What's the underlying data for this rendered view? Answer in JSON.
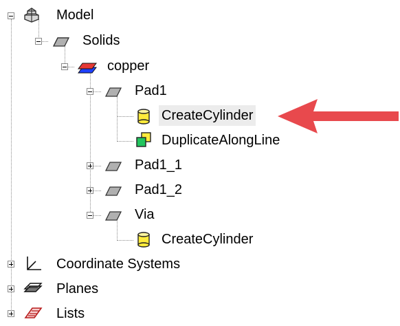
{
  "tree": {
    "model": {
      "label": "Model",
      "icon": "model-icon"
    },
    "solids": {
      "label": "Solids",
      "icon": "solid-icon"
    },
    "copper": {
      "label": "copper",
      "icon": "material-icon"
    },
    "pad1": {
      "label": "Pad1",
      "icon": "solid-icon"
    },
    "pad1_create": {
      "label": "CreateCylinder",
      "icon": "cylinder-icon",
      "selected": true
    },
    "pad1_dup": {
      "label": "DuplicateAlongLine",
      "icon": "duplicate-icon"
    },
    "pad1_1": {
      "label": "Pad1_1",
      "icon": "solid-icon"
    },
    "pad1_2": {
      "label": "Pad1_2",
      "icon": "solid-icon"
    },
    "via": {
      "label": "Via",
      "icon": "solid-icon"
    },
    "via_create": {
      "label": "CreateCylinder",
      "icon": "cylinder-icon"
    },
    "coord": {
      "label": "Coordinate Systems",
      "icon": "coordinate-axes-icon"
    },
    "planes": {
      "label": "Planes",
      "icon": "plane-icon"
    },
    "lists": {
      "label": "Lists",
      "icon": "list-icon"
    }
  },
  "colors": {
    "arrow": "#e8494d",
    "selection": "#ececec",
    "copper_top": "#e53935",
    "copper_bottom": "#1e40ff"
  }
}
